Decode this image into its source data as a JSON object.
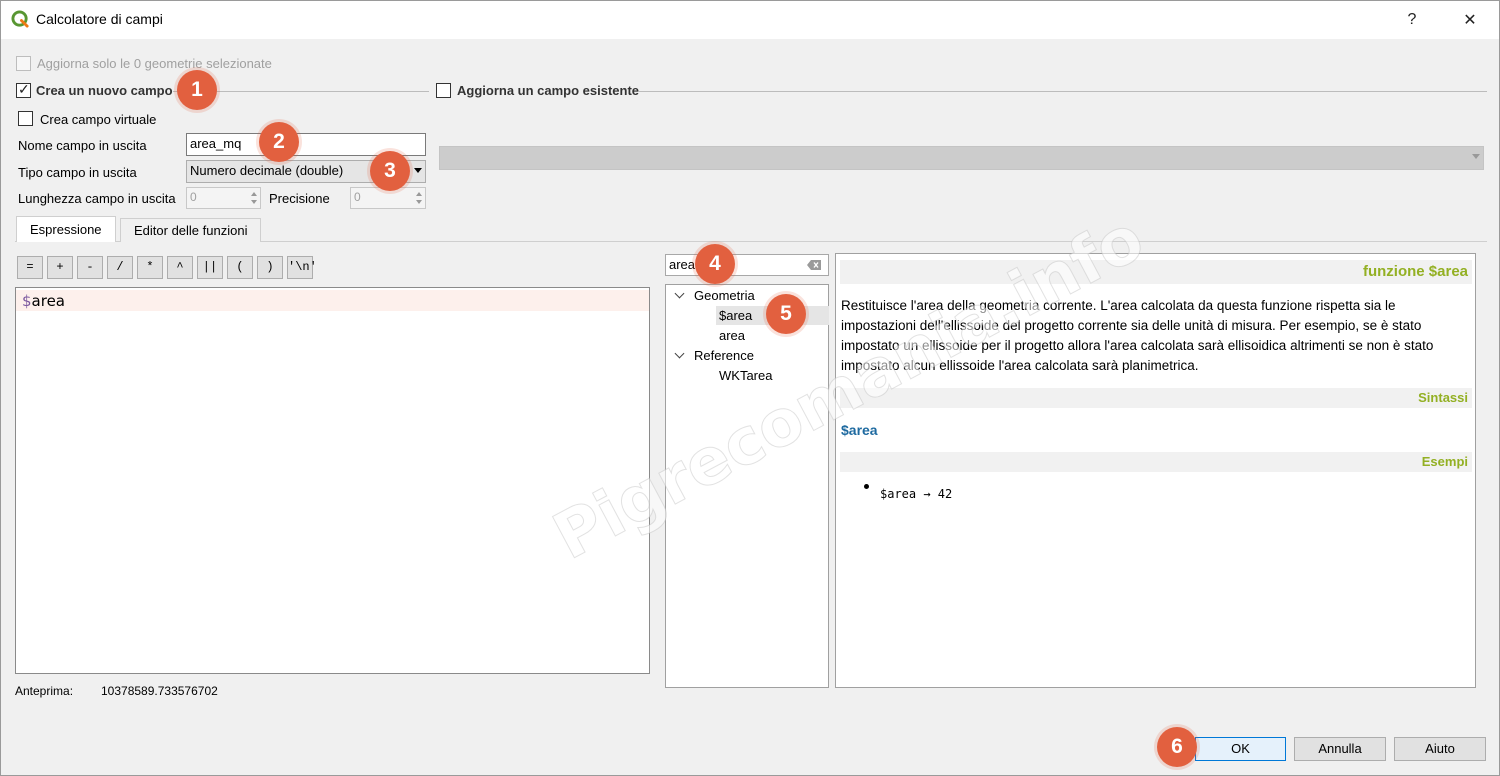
{
  "window": {
    "title": "Calcolatore di campi",
    "help_glyph": "?",
    "close_glyph": "✕"
  },
  "options": {
    "update_selected_label": "Aggiorna solo le 0 geometrie selezionate",
    "update_selected_checked": false,
    "create_new_field_label": "Crea un nuovo campo",
    "create_new_field_checked": true,
    "update_existing_label": "Aggiorna un campo esistente",
    "update_existing_checked": false,
    "virtual_field_label": "Crea campo virtuale",
    "virtual_field_checked": false
  },
  "new_field": {
    "name_label": "Nome campo in uscita",
    "name_value": "area_mq",
    "type_label": "Tipo campo in uscita",
    "type_value": "Numero decimale (double)",
    "length_label": "Lunghezza campo in uscita",
    "length_value": "0",
    "precision_label": "Precisione",
    "precision_value": "0"
  },
  "tabs": [
    {
      "label": "Espressione",
      "active": true
    },
    {
      "label": "Editor delle funzioni",
      "active": false
    }
  ],
  "operators": [
    "=",
    "+",
    "-",
    "/",
    "*",
    "^",
    "||",
    "(",
    ")",
    "'\\n'"
  ],
  "expression": {
    "text": "$area"
  },
  "preview": {
    "label": "Anteprima:",
    "value": "10378589.733576702"
  },
  "function_search": {
    "value": "area"
  },
  "function_tree": [
    {
      "group": "Geometria",
      "expanded": true,
      "items": [
        "$area",
        "area"
      ],
      "selected": "$area"
    },
    {
      "group": "Reference",
      "expanded": true,
      "items": [
        "WKTarea"
      ]
    }
  ],
  "help": {
    "title": "funzione $area",
    "description": "Restituisce l'area della geometria corrente. L'area calcolata da questa funzione rispetta sia le impostazioni dell'ellissoide del progetto corrente sia delle unità di misura. Per esempio, se è stato impostato un ellissoide per il progetto allora l'area calcolata sarà ellisoidica altrimenti se non è stato impostato alcun ellissoide l'area calcolata sarà planimetrica.",
    "syntax_heading": "Sintassi",
    "syntax": "$area",
    "examples_heading": "Esempi",
    "example": "$area → 42"
  },
  "buttons": {
    "ok": "OK",
    "cancel": "Annulla",
    "help": "Aiuto"
  },
  "markers": [
    "1",
    "2",
    "3",
    "4",
    "5",
    "6"
  ],
  "watermark": "Pigrecomania.info",
  "colors": {
    "accent_green": "#93b023",
    "syntax_blue": "#1e6aa0",
    "marker_orange": "#e2603f",
    "expression_line_bg": "#fdf0ec"
  }
}
